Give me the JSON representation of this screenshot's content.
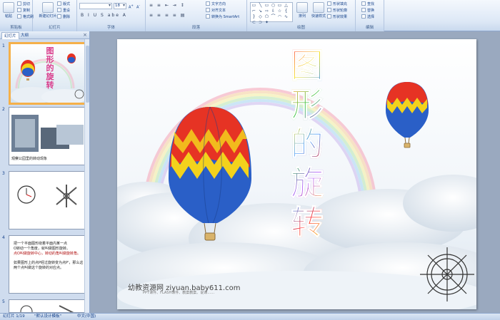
{
  "ribbon": {
    "clipboard": {
      "label": "剪贴板",
      "paste": "粘贴",
      "cut": "剪切",
      "copy": "复制",
      "format_painter": "格式刷"
    },
    "slides": {
      "label": "幻灯片",
      "new_slide": "新建幻灯片",
      "layout": "版式",
      "reset": "重设",
      "delete": "删除"
    },
    "font": {
      "label": "字体",
      "size": "18",
      "format_row": "B I U S abe A"
    },
    "paragraph": {
      "label": "段落",
      "text_direction": "文字方向",
      "align_text": "对齐文本",
      "smartart": "转换为 SmartArt"
    },
    "drawing": {
      "label": "绘图",
      "arrange": "排列",
      "quick_styles": "快速样式",
      "shape_fill": "形状填充",
      "shape_outline": "形状轮廓",
      "shape_effects": "形状效果",
      "shapes": [
        "▭",
        "╲",
        "▭",
        "○",
        "▭",
        "△",
        "⌐",
        "↘",
        "⇨",
        "⇩",
        "☆",
        "{",
        "}",
        "◇",
        "⬠",
        "⌒",
        "◠",
        "∿",
        "⊂",
        "⊃",
        "✦"
      ]
    },
    "editing": {
      "label": "编辑",
      "find": "查找",
      "replace": "替换",
      "select": "选择"
    }
  },
  "left_pane": {
    "tabs": [
      "幻灯片",
      "大纲"
    ],
    "close": "×",
    "thumbnails": [
      {
        "number": "1",
        "title": "图形的旋转",
        "selected": true
      },
      {
        "number": "2",
        "caption": "观察公园里的转动现象"
      },
      {
        "number": "3"
      },
      {
        "number": "4",
        "text_lines": [
          "把一个平面图形绕着平面内某一点",
          "O转动一个角度，就叫做图形旋转。",
          "点O叫做旋转中心，转动的角叫做旋转角。",
          "如果图形上的点P经过旋转变为点P'，那么这",
          "两个点叫做这个旋转的对应点。"
        ]
      },
      {
        "number": "5"
      }
    ]
  },
  "slide": {
    "title_chars": [
      "图",
      "形",
      "的",
      "旋",
      "转"
    ],
    "footer_site": "幼教资源网 ziyuan.baby611.com",
    "footer_sub": "PPT课件、FLASH课件、教案教案、说课……"
  },
  "statusbar": {
    "slide_count": "幻灯片 1/19",
    "theme": "\"默认设计模板\"",
    "language": "中文(中国)"
  },
  "colors": {
    "accent": "#f5b049",
    "ribbon": "#dde8f6",
    "workspace": "#9aa9bf",
    "title_gradient": [
      "#ff3b3b",
      "#ff9f1a",
      "#f5e21b",
      "#38c84b",
      "#2f8fff",
      "#a13bff"
    ]
  }
}
